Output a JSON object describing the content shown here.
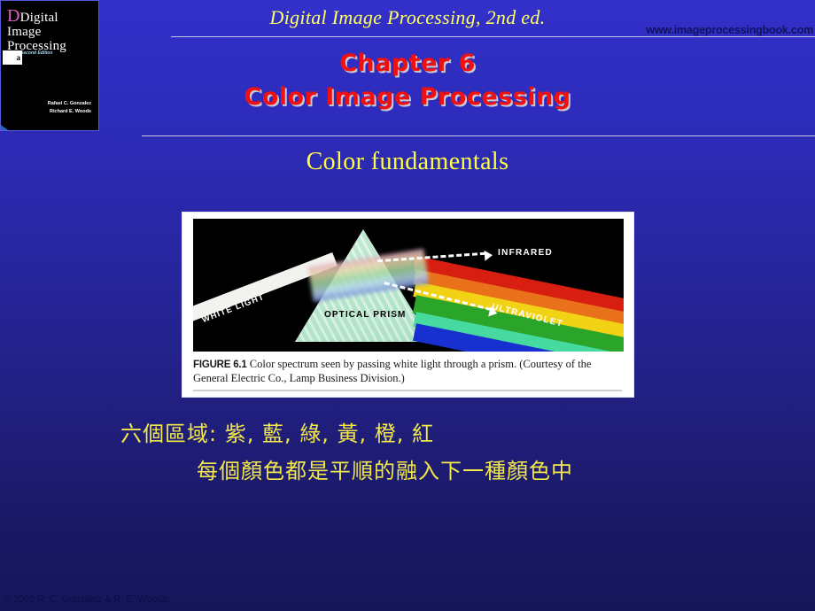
{
  "header": {
    "title": "Digital Image Processing, 2nd ed.",
    "url": "www.imageprocessingbook.com"
  },
  "chapter": {
    "line1": "Chapter 6",
    "line2": "Color Image Processing",
    "color": "#f01010",
    "shadow_color": "#c6c6d6"
  },
  "section": {
    "title": "Color fundamentals",
    "color": "#ffff44"
  },
  "book_cover": {
    "title_line1": "Digital",
    "title_line2": "Image",
    "title_line3": "Processing",
    "edition": "Second Edition",
    "author1": "Rafael C. Gonzalez",
    "author2": "Richard E. Woods",
    "spine_badge": "a"
  },
  "figure": {
    "label_white_light": "WHITE LIGHT",
    "label_optical_prism": "OPTICAL PRISM",
    "label_infrared": "INFRARED",
    "label_ultraviolet": "ULTRAVIOLET",
    "caption_bold": "FIGURE 6.1",
    "caption_text": "Color spectrum seen by passing white light through a prism. (Courtesy of the General Electric Co., Lamp Business Division.)",
    "spectrum_bands": [
      {
        "name": "red",
        "color": "#d81e10"
      },
      {
        "name": "orange",
        "color": "#e8711a"
      },
      {
        "name": "yellow",
        "color": "#f2d215"
      },
      {
        "name": "green",
        "color": "#2aa52a"
      },
      {
        "name": "cyan",
        "color": "#46d9a0"
      },
      {
        "name": "blue",
        "color": "#1830cf"
      }
    ]
  },
  "notes": {
    "line1": "六個區域: 紫, 藍, 綠, 黃, 橙, 紅",
    "line2": "每個顏色都是平順的融入下一種顏色中",
    "color": "#f2e84a"
  },
  "footer": {
    "copyright": "© 2002 R. C. Gonzalez & R. E. Woods"
  },
  "theme": {
    "background_top": "#3230c9",
    "background_bottom": "#161559",
    "rule_color": "#c8c8e8"
  }
}
